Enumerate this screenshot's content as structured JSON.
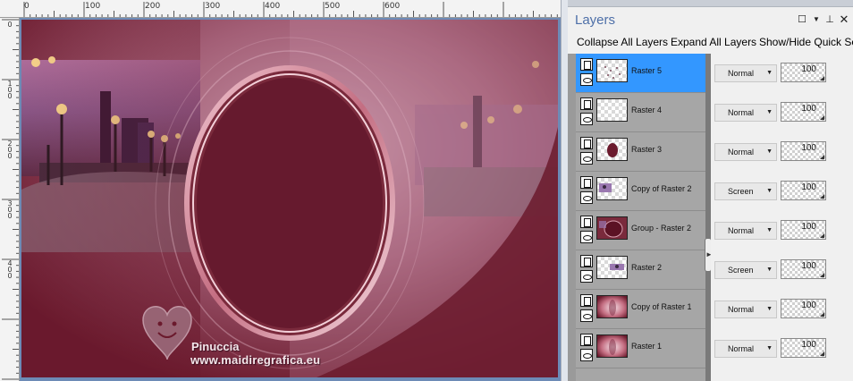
{
  "ruler": {
    "h_labels": [
      "0",
      "100",
      "200",
      "300",
      "400",
      "500",
      "600"
    ],
    "v_labels": [
      "0",
      "1 0 0",
      "2 0 0",
      "3 0 0",
      "4 0 0"
    ]
  },
  "watermark": {
    "name": "Pinuccia",
    "url": "www.maidiregrafica.eu"
  },
  "colors": {
    "canvas_bg": "#6d8bb6",
    "art_maroon": "#6b1a2d",
    "selected_row": "#3397ff",
    "panel_title": "#4d6fa8"
  },
  "layers_panel": {
    "title": "Layers",
    "title_buttons": [
      "maximize-icon",
      "dropdown-icon",
      "pin-icon",
      "close-icon"
    ],
    "toolbar": {
      "collapse_all": "Collapse All Layers",
      "expand_all": "Expand All Layers",
      "show_hide_quick": "Show/Hide Quick Se"
    },
    "layers": [
      {
        "name": "Raster 5",
        "blend": "Normal",
        "opacity": "100",
        "selected": true,
        "thumb": "dots"
      },
      {
        "name": "Raster 4",
        "blend": "Normal",
        "opacity": "100",
        "selected": false,
        "thumb": "empty"
      },
      {
        "name": "Raster 3",
        "blend": "Normal",
        "opacity": "100",
        "selected": false,
        "thumb": "oval"
      },
      {
        "name": "Copy of Raster 2",
        "blend": "Screen",
        "opacity": "100",
        "selected": false,
        "thumb": "city-left"
      },
      {
        "name": "Group - Raster 2",
        "blend": "Normal",
        "opacity": "100",
        "selected": false,
        "thumb": "group"
      },
      {
        "name": "Raster 2",
        "blend": "Screen",
        "opacity": "100",
        "selected": false,
        "thumb": "city-center"
      },
      {
        "name": "Copy of Raster 1",
        "blend": "Normal",
        "opacity": "100",
        "selected": false,
        "thumb": "gradient"
      },
      {
        "name": "Raster 1",
        "blend": "Normal",
        "opacity": "100",
        "selected": false,
        "thumb": "gradient"
      }
    ]
  }
}
